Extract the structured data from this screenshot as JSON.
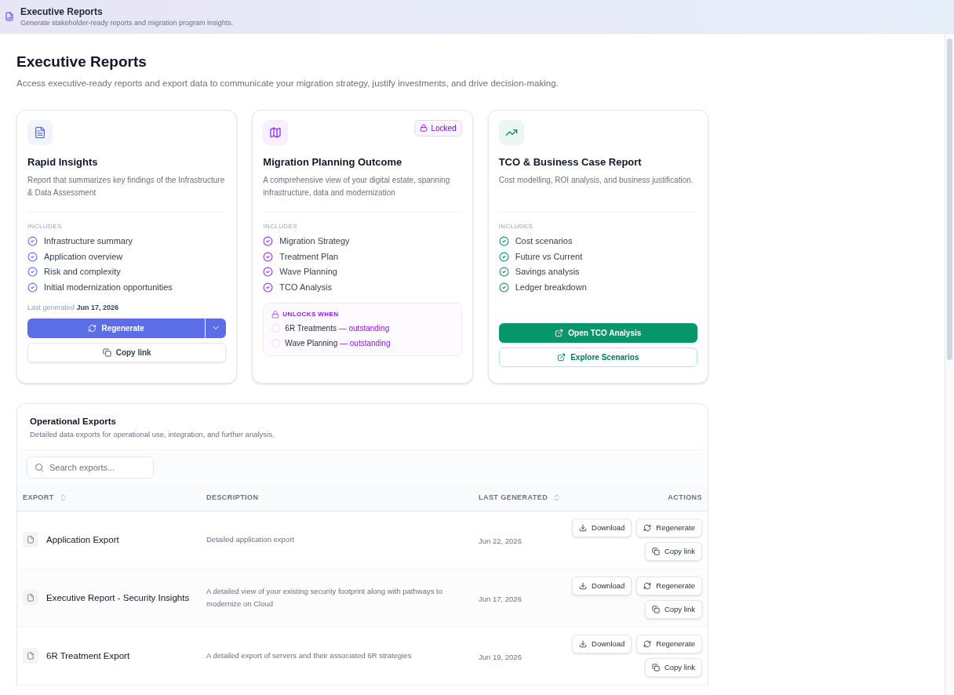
{
  "topbar": {
    "title": "Executive Reports",
    "subtitle": "Generate stakeholder-ready reports and migration program insights."
  },
  "page": {
    "title": "Executive Reports",
    "subtitle": "Access executive-ready reports and export data to communicate your migration strategy, justify investments, and drive decision-making."
  },
  "cards": [
    {
      "kind": "generate",
      "color": "#5b6ee8",
      "title": "Rapid Insights",
      "description": "Report that summarizes key findings of the Infrastructure & Data Assessment",
      "includes_label": "INCLUDES",
      "includes": [
        "Infrastructure summary",
        "Application overview",
        "Risk and complexity",
        "Initial modernization opportunities"
      ],
      "last_generated_label": "Last generated",
      "last_generated": "Jun 17, 2026",
      "primary_button": "Regenerate",
      "secondary_button": "Copy link"
    },
    {
      "kind": "locked",
      "color": "#9333ea",
      "title": "Migration Planning Outcome",
      "badge": "Locked",
      "description": "A comprehensive view of your digital estate, spanning infrastructure, data and modernization",
      "includes_label": "INCLUDES",
      "includes": [
        "Migration Strategy",
        "Treatment Plan",
        "Wave Planning",
        "TCO Analysis"
      ],
      "unlocks_label": "UNLOCKS WHEN",
      "conditions": [
        {
          "label": "6R Treatments",
          "status": "— outstanding",
          "checked": false
        },
        {
          "label": "Wave Planning",
          "status": "— outstanding",
          "checked": false
        }
      ]
    },
    {
      "kind": "open",
      "color": "#059669",
      "title": "TCO & Business Case Report",
      "description": "Cost modelling, ROI analysis, and business justification.",
      "includes_label": "INCLUDES",
      "includes": [
        "Cost scenarios",
        "Future vs Current",
        "Savings analysis",
        "Ledger breakdown"
      ],
      "primary_button": "Open TCO Analysis",
      "secondary_button": "Explore Scenarios"
    }
  ],
  "exports": {
    "title": "Operational Exports",
    "subtitle": "Detailed data exports for operational use, integration, and further analysis.",
    "search": {
      "placeholder": "Search exports..."
    },
    "columns": [
      {
        "label": "EXPORT",
        "sortable": true
      },
      {
        "label": "DESCRIPTION",
        "sortable": false
      },
      {
        "label": "LAST GENERATED",
        "sortable": true
      },
      {
        "label": "ACTIONS",
        "sortable": false
      }
    ],
    "rows": [
      {
        "name": "Application Export",
        "description": "Detailed application export",
        "date": "Jun 22, 2026",
        "actions": [
          "Download",
          "Regenerate",
          "Copy link"
        ]
      },
      {
        "name": "Executive Report - Security Insights",
        "description": "A detailed view of your existing security footprint along with pathways to modernize on Cloud",
        "date": "Jun 17, 2026",
        "actions": [
          "Download",
          "Regenerate",
          "Copy link"
        ]
      },
      {
        "name": "6R Treatment Export",
        "description": "A detailed export of servers and their associated 6R strategies",
        "date": "Jun 19, 2026",
        "actions": [
          "Download",
          "Regenerate",
          "Copy link"
        ]
      }
    ]
  }
}
